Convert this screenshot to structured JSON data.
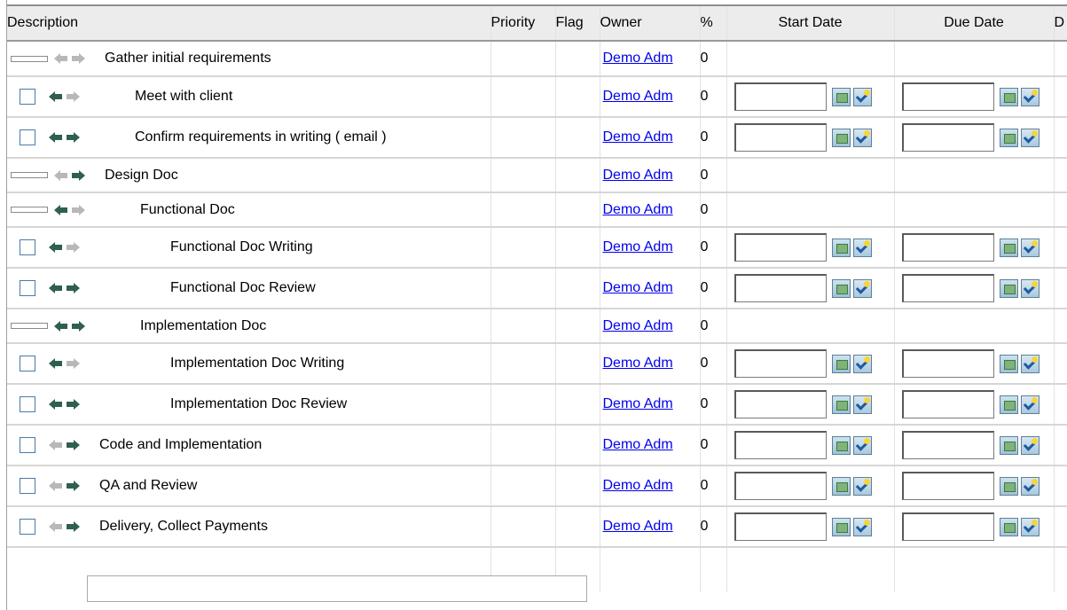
{
  "columns": {
    "description": "Description",
    "priority": "Priority",
    "flag": "Flag",
    "owner": "Owner",
    "pct": "%",
    "start_date": "Start Date",
    "due_date": "Due Date",
    "next_partial": "D"
  },
  "tasks": [
    {
      "name": "Gather initial requirements",
      "level": 0,
      "kind": "group",
      "left_arrow": "disabled",
      "right_arrow": "disabled",
      "owner": "Demo Adm",
      "pct": "0"
    },
    {
      "name": "Meet with client",
      "level": 1,
      "kind": "task",
      "left_arrow": "enabled",
      "right_arrow": "disabled",
      "owner": "Demo Adm",
      "pct": "0"
    },
    {
      "name": "Confirm requirements in writing ( email )",
      "level": 1,
      "kind": "task",
      "left_arrow": "enabled",
      "right_arrow": "enabled",
      "owner": "Demo Adm",
      "pct": "0"
    },
    {
      "name": "Design Doc",
      "level": 0,
      "kind": "group",
      "left_arrow": "disabled",
      "right_arrow": "enabled",
      "owner": "Demo Adm",
      "pct": "0"
    },
    {
      "name": "Functional Doc",
      "level": 1,
      "kind": "group",
      "left_arrow": "enabled",
      "right_arrow": "disabled",
      "owner": "Demo Adm",
      "pct": "0"
    },
    {
      "name": "Functional Doc Writing",
      "level": 2,
      "kind": "task",
      "left_arrow": "enabled",
      "right_arrow": "disabled",
      "owner": "Demo Adm",
      "pct": "0"
    },
    {
      "name": "Functional Doc Review",
      "level": 2,
      "kind": "task",
      "left_arrow": "enabled",
      "right_arrow": "enabled",
      "owner": "Demo Adm",
      "pct": "0"
    },
    {
      "name": "Implementation Doc",
      "level": 1,
      "kind": "group",
      "left_arrow": "enabled",
      "right_arrow": "enabled",
      "owner": "Demo Adm",
      "pct": "0"
    },
    {
      "name": "Implementation Doc Writing",
      "level": 2,
      "kind": "task",
      "left_arrow": "enabled",
      "right_arrow": "disabled",
      "owner": "Demo Adm",
      "pct": "0"
    },
    {
      "name": "Implementation Doc Review",
      "level": 2,
      "kind": "task",
      "left_arrow": "enabled",
      "right_arrow": "enabled",
      "owner": "Demo Adm",
      "pct": "0"
    },
    {
      "name": "Code and Implementation",
      "level": 0,
      "kind": "task",
      "left_arrow": "disabled",
      "right_arrow": "enabled",
      "owner": "Demo Adm",
      "pct": "0"
    },
    {
      "name": "QA and Review",
      "level": 0,
      "kind": "task",
      "left_arrow": "disabled",
      "right_arrow": "enabled",
      "owner": "Demo Adm",
      "pct": "0"
    },
    {
      "name": "Delivery, Collect Payments",
      "level": 0,
      "kind": "task",
      "left_arrow": "disabled",
      "right_arrow": "enabled",
      "owner": "Demo Adm",
      "pct": "0"
    }
  ],
  "new_task_input": {
    "value": "",
    "placeholder": ""
  },
  "colors": {
    "arrow_enabled": "#2f5f4f",
    "arrow_disabled": "#b8b8b8",
    "link": "#0000ee",
    "header_bg": "#ececec"
  },
  "icons": {
    "left": "arrow-left-icon",
    "right": "arrow-right-icon",
    "calendar": "calendar-icon",
    "picker": "date-wizard-icon"
  }
}
